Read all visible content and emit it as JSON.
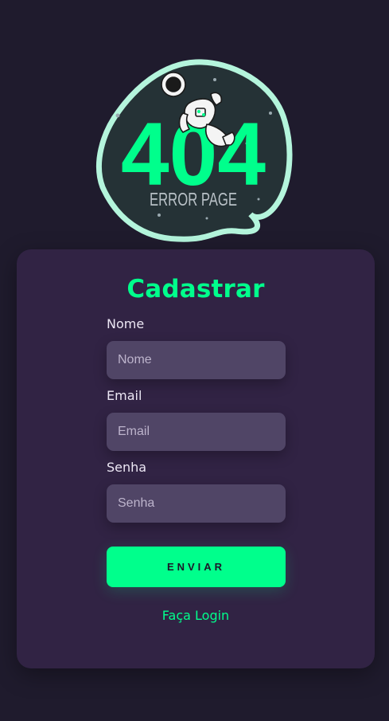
{
  "illustration": {
    "icon": "astronaut-icon",
    "code": "404",
    "caption": "ERROR PAGE",
    "accent_color": "#00ff8c",
    "blob_border_color": "#b4f5dc"
  },
  "form": {
    "title": "Cadastrar",
    "fields": [
      {
        "label": "Nome",
        "placeholder": "Nome",
        "value": ""
      },
      {
        "label": "Email",
        "placeholder": "Email",
        "value": ""
      },
      {
        "label": "Senha",
        "placeholder": "Senha",
        "value": ""
      }
    ],
    "submit_label": "ENVIAR",
    "login_link": "Faça Login"
  },
  "colors": {
    "background": "#1f1b2d",
    "card": "#312344",
    "input": "#504566",
    "accent": "#00ff8c"
  }
}
